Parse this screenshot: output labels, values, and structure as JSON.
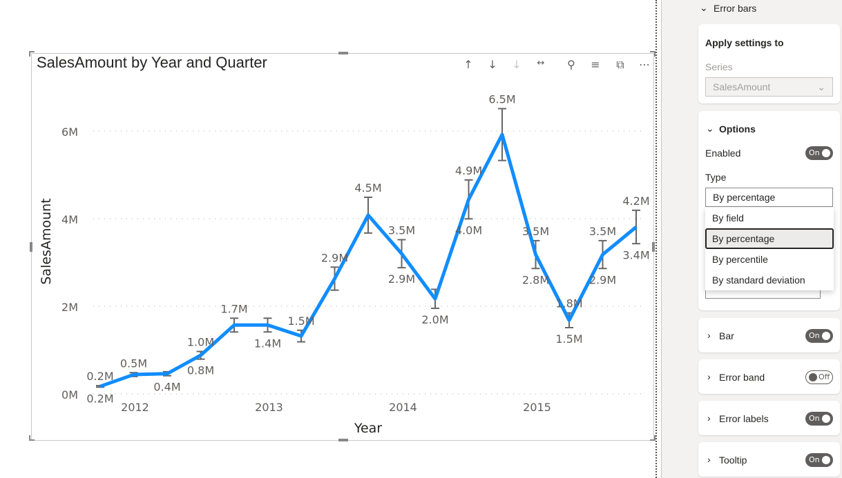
{
  "visual": {
    "title": "SalesAmount by Year and Quarter",
    "header_icons": [
      "arrow-up-icon",
      "arrow-down-icon",
      "arrow-down-disabled-icon",
      "expand-hierarchy-icon",
      "pin-icon",
      "filter-icon",
      "focus-mode-icon",
      "more-options-icon"
    ]
  },
  "chart_data": {
    "type": "line",
    "title": "SalesAmount by Year and Quarter",
    "xlabel": "Year",
    "ylabel": "SalesAmount",
    "ylim": [
      0,
      6.6
    ],
    "y_ticks": [
      "0M",
      "2M",
      "4M",
      "6M"
    ],
    "y_tick_values": [
      0,
      2,
      4,
      6
    ],
    "x_ticks": [
      {
        "label": "2012",
        "index": 1
      },
      {
        "label": "2013",
        "index": 5
      },
      {
        "label": "2014",
        "index": 9
      },
      {
        "label": "2015",
        "index": 13
      }
    ],
    "grid": true,
    "color": "#118DFF",
    "values": [
      0.17,
      0.44,
      0.46,
      0.88,
      1.57,
      1.57,
      1.32,
      2.63,
      4.08,
      3.2,
      2.17,
      4.44,
      5.92,
      3.18,
      1.68,
      3.18,
      3.81
    ],
    "error_bars": {
      "type": "By percentage",
      "percent": 10
    },
    "data_labels": [
      {
        "i": 0,
        "pos": "above",
        "text": "0.2M"
      },
      {
        "i": 0,
        "pos": "below",
        "text": "0.2M"
      },
      {
        "i": 1,
        "pos": "above",
        "text": "0.5M"
      },
      {
        "i": 2,
        "pos": "below",
        "text": "0.4M"
      },
      {
        "i": 3,
        "pos": "above",
        "text": "1.0M"
      },
      {
        "i": 3,
        "pos": "below",
        "text": "0.8M"
      },
      {
        "i": 4,
        "pos": "above",
        "text": "1.7M"
      },
      {
        "i": 5,
        "pos": "below",
        "text": "1.4M"
      },
      {
        "i": 6,
        "pos": "above",
        "text": "1.5M"
      },
      {
        "i": 7,
        "pos": "above",
        "text": "2.9M"
      },
      {
        "i": 8,
        "pos": "above",
        "text": "4.5M"
      },
      {
        "i": 9,
        "pos": "above",
        "text": "3.5M"
      },
      {
        "i": 9,
        "pos": "below",
        "text": "2.9M"
      },
      {
        "i": 10,
        "pos": "below",
        "text": "2.0M"
      },
      {
        "i": 11,
        "pos": "above",
        "text": "4.9M"
      },
      {
        "i": 11,
        "pos": "below",
        "text": "4.0M"
      },
      {
        "i": 12,
        "pos": "above",
        "text": "6.5M"
      },
      {
        "i": 13,
        "pos": "above",
        "text": "3.5M"
      },
      {
        "i": 13,
        "pos": "below",
        "text": "2.8M"
      },
      {
        "i": 14,
        "pos": "above",
        "text": "1.8M"
      },
      {
        "i": 14,
        "pos": "below",
        "text": "1.5M"
      },
      {
        "i": 15,
        "pos": "above",
        "text": "3.5M"
      },
      {
        "i": 15,
        "pos": "below",
        "text": "2.9M"
      },
      {
        "i": 16,
        "pos": "above",
        "text": "4.2M"
      },
      {
        "i": 16,
        "pos": "below",
        "text": "3.4M"
      }
    ]
  },
  "pane": {
    "section": "Error bars",
    "apply": {
      "title": "Apply settings to",
      "series_label": "Series",
      "series_value": "SalesAmount"
    },
    "options": {
      "title": "Options",
      "enabled_label": "Enabled",
      "enabled_state": "On",
      "type_label": "Type",
      "type_value": "By percentage",
      "type_options": [
        "By field",
        "By percentage",
        "By percentile",
        "By standard deviation"
      ],
      "selected": "By percentage"
    },
    "cards": [
      {
        "label": "Bar",
        "state": "On"
      },
      {
        "label": "Error band",
        "state": "Off"
      },
      {
        "label": "Error labels",
        "state": "On"
      },
      {
        "label": "Tooltip",
        "state": "On"
      }
    ]
  }
}
